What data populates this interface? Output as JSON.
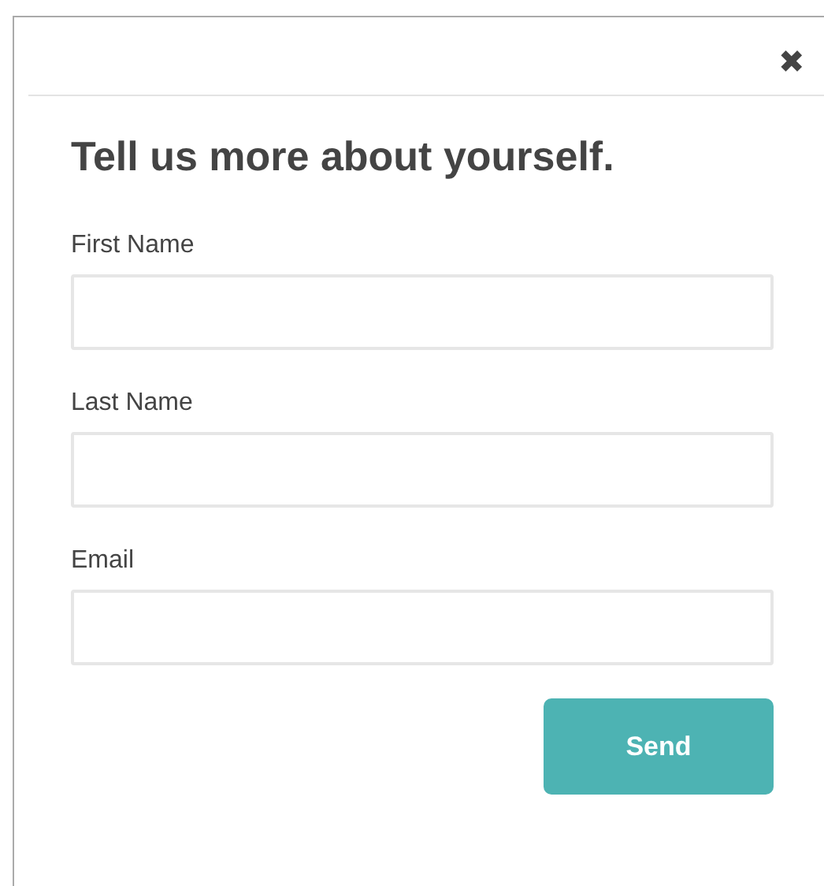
{
  "dialog": {
    "close": "✖",
    "title": "Tell us more about yourself.",
    "fields": [
      {
        "label": "First Name"
      },
      {
        "label": "Last Name"
      },
      {
        "label": "Email"
      }
    ],
    "submit": "Send"
  }
}
